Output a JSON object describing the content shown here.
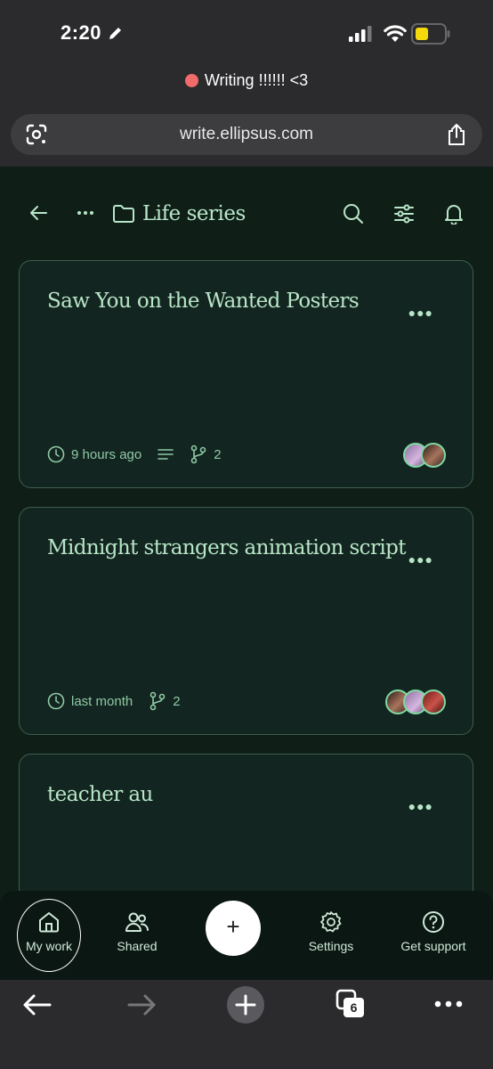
{
  "status": {
    "time": "2:20"
  },
  "browser": {
    "page_title": "Writing !!!!!! <3",
    "url": "write.ellipsus.com",
    "tab_count": "6"
  },
  "header": {
    "folder_title": "Life series"
  },
  "cards": [
    {
      "title": "Saw You on the Wanted Posters",
      "time": "9 hours ago",
      "branches": "2",
      "avatars": 2
    },
    {
      "title": "Midnight strangers animation script",
      "time": "last month",
      "branches": "2",
      "avatars": 3
    },
    {
      "title": "teacher au"
    }
  ],
  "nav": {
    "my_work": "My work",
    "shared": "Shared",
    "add": "+",
    "settings": "Settings",
    "support": "Get support"
  },
  "colors": {
    "accent": "#b8e6c8",
    "background": "#0f1f18",
    "card_border": "#3e5d4c"
  }
}
